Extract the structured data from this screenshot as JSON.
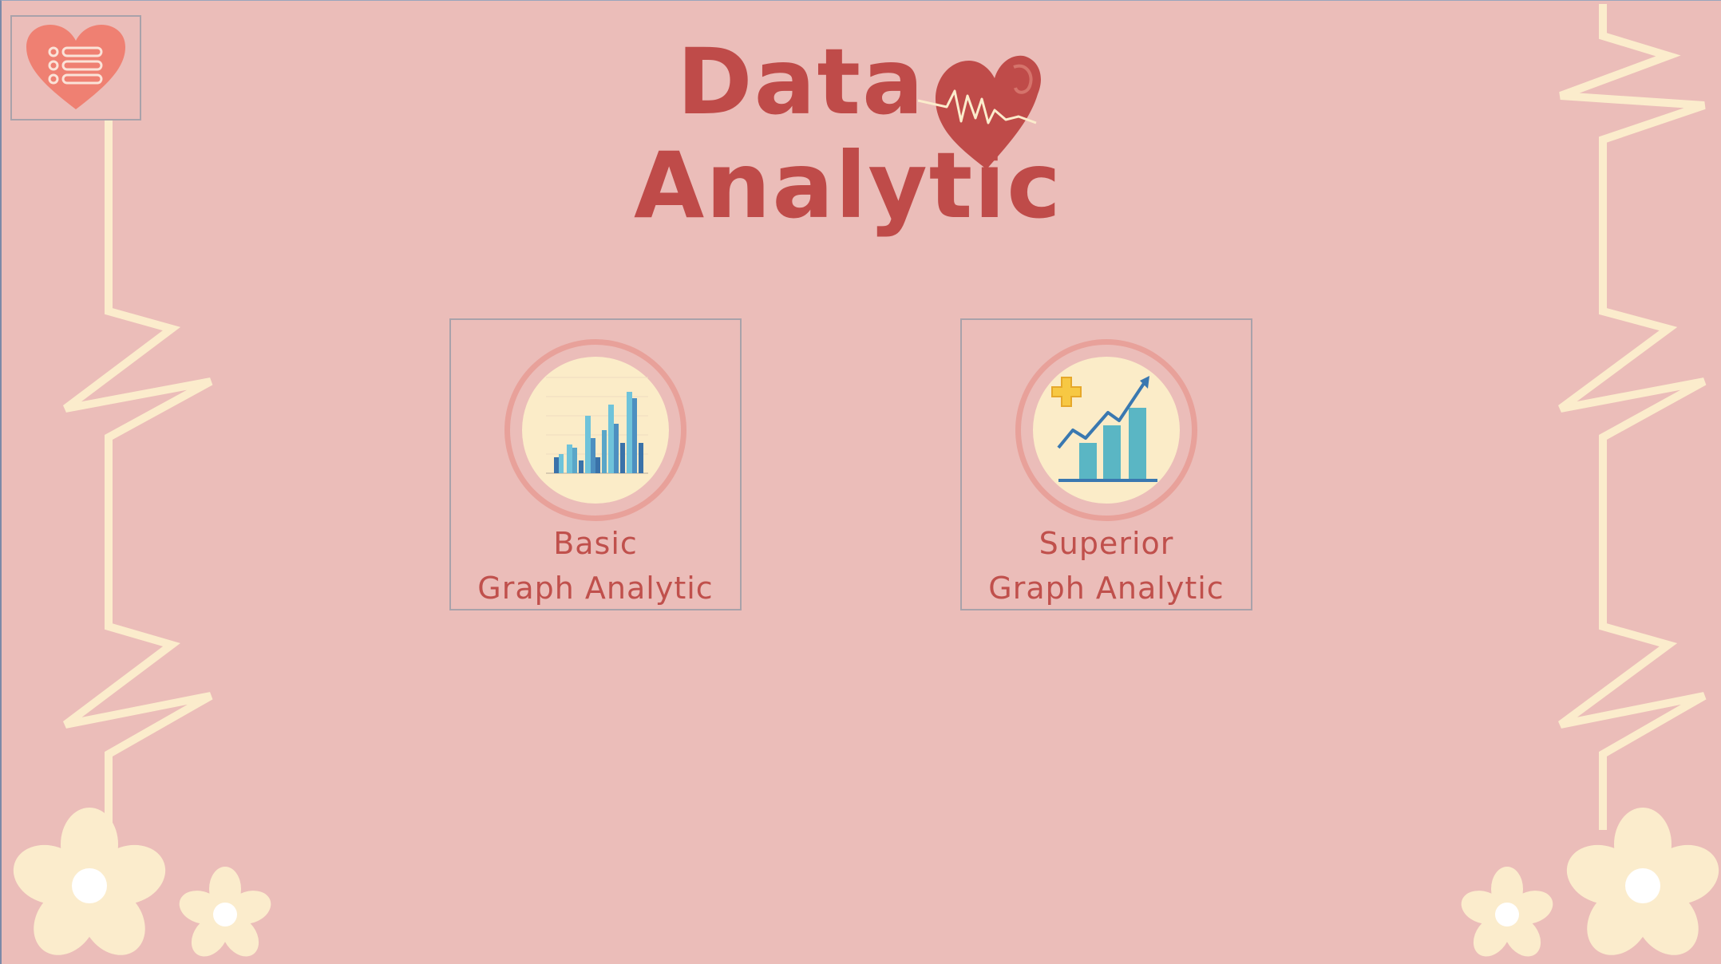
{
  "title": {
    "line1": "Data",
    "line2": "Analytic"
  },
  "menu": {
    "icon": "heart-list-icon"
  },
  "cards": [
    {
      "line1": "Basic",
      "line2": "Graph Analytic",
      "icon": "bar-chart-icon"
    },
    {
      "line1": "Superior",
      "line2": "Graph Analytic",
      "icon": "growth-chart-icon"
    }
  ],
  "colors": {
    "background": "#ebbdb9",
    "accent": "#bf4b49",
    "cream": "#fbecc8",
    "heart": "#ef8072",
    "teal": "#5ab6c4"
  }
}
